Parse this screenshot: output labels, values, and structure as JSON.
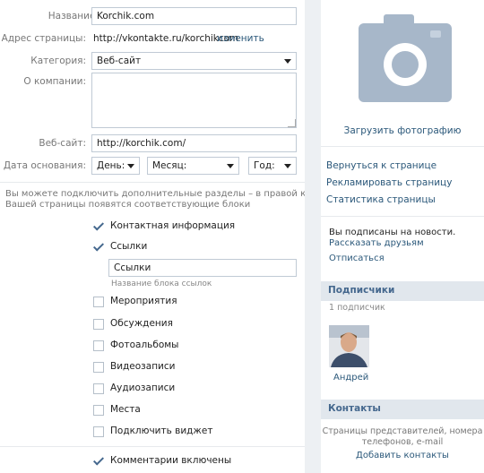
{
  "form": {
    "name_label": "Название:",
    "name_value": "Korchik.com",
    "address_label": "Адрес страницы:",
    "address_value": "http://vkontakte.ru/korchikcom",
    "address_change": "изменить",
    "category_label": "Категория:",
    "category_value": "Веб-сайт",
    "about_label": "О компании:",
    "about_value": "",
    "website_label": "Веб-сайт:",
    "website_value": "http://korchik.com/",
    "founded_label": "Дата основания:",
    "day_select": "День:",
    "month_select": "Месяц:",
    "year_select": "Год:"
  },
  "sections": {
    "hint_line1": "Вы можете подключить дополнительные разделы – в правой колонке",
    "hint_line2": "Вашей страницы появятся соответствующие блоки",
    "items": [
      {
        "label": "Контактная информация",
        "checked": true
      },
      {
        "label": "Ссылки",
        "checked": true
      },
      {
        "label": "Мероприятия",
        "checked": false
      },
      {
        "label": "Обсуждения",
        "checked": false
      },
      {
        "label": "Фотоальбомы",
        "checked": false
      },
      {
        "label": "Видеозаписи",
        "checked": false
      },
      {
        "label": "Аудиозаписи",
        "checked": false
      },
      {
        "label": "Места",
        "checked": false
      },
      {
        "label": "Подключить виджет",
        "checked": false
      }
    ],
    "links_block_value": "Ссылки",
    "links_block_hint": "Название блока ссылок",
    "comments_label": "Комментарии включены",
    "comments_checked": true
  },
  "sidebar": {
    "upload_photo": "Загрузить фотографию",
    "links": [
      "Вернуться к странице",
      "Рекламировать страницу",
      "Статистика страницы"
    ],
    "subscribed_text": "Вы подписаны на новости.",
    "tell_friends": "Рассказать друзьям",
    "unsubscribe": "Отписаться",
    "subscribers_title": "Подписчики",
    "subscribers_count": "1 подписчик",
    "subscriber_name": "Андрей",
    "contacts_title": "Контакты",
    "contacts_hint_line1": "Страницы представителей, номера",
    "contacts_hint_line2": "телефонов, e-mail",
    "add_contacts": "Добавить контакты"
  }
}
